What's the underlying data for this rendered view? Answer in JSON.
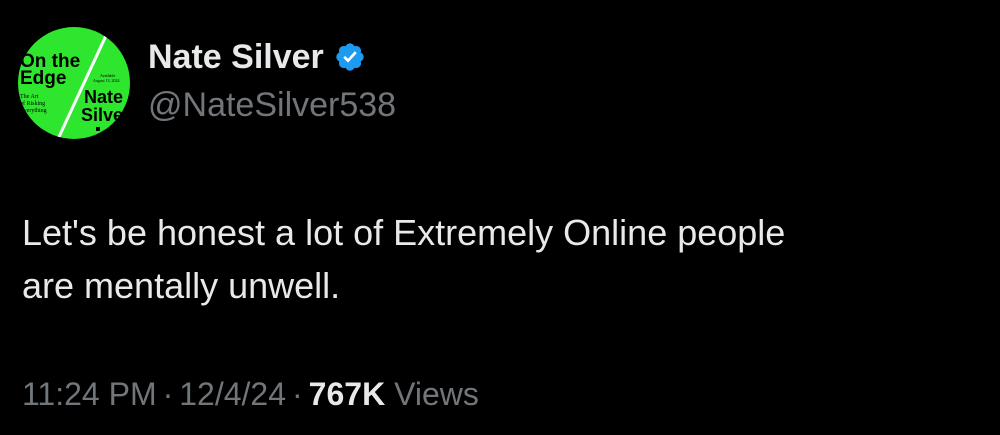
{
  "author": {
    "display_name": "Nate Silver",
    "handle": "@NateSilver538",
    "verified": true,
    "avatar": {
      "book_title_line1": "On the",
      "book_title_line2": "Edge",
      "author_line1": "Nate",
      "author_line2": "Silver",
      "subtitle_line1": "The Art",
      "subtitle_line2": "of Risking",
      "subtitle_line3": "Everything",
      "blurb_line1": "Available",
      "blurb_line2": "August 13, 2024",
      "background_color": "#2ee62e"
    }
  },
  "tweet": {
    "text_line1": "Let's be honest a lot of Extremely Online people",
    "text_line2": "are mentally unwell."
  },
  "meta": {
    "time": "11:24 PM",
    "separator": "·",
    "date": "12/4/24",
    "views_count": "767K",
    "views_label": "Views"
  },
  "colors": {
    "background": "#000000",
    "primary_text": "#e7e9ea",
    "secondary_text": "#71767b",
    "verified_badge": "#1d9bf0"
  }
}
